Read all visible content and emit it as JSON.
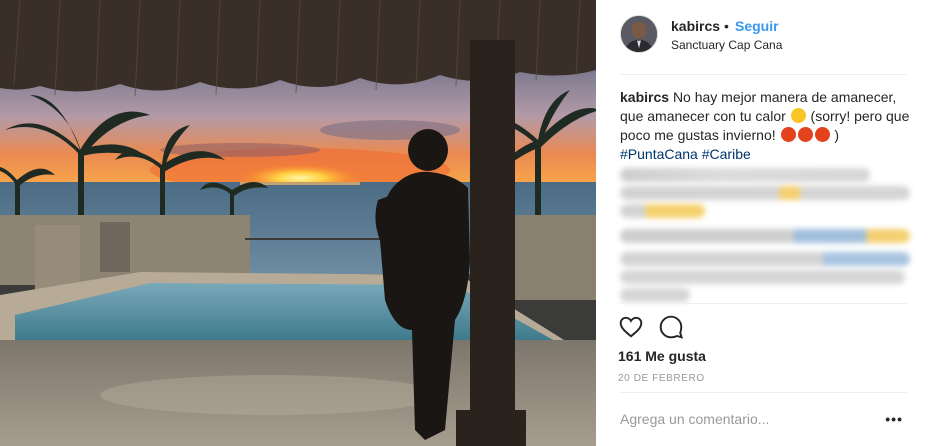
{
  "post": {
    "username": "kabircs",
    "separator": "•",
    "follow_label": "Seguir",
    "location": "Sanctuary Cap Cana",
    "caption_username": "kabircs",
    "caption_part1": "No hay mejor manera de amanecer, que amanecer con tu calor",
    "caption_part2": "(sorry! pero que poco me gustas invierno!",
    "caption_part3": ")",
    "hashtags": [
      "#PuntaCana",
      "#Caribe"
    ],
    "likes": "161 Me gusta",
    "date": "20 DE FEBRERO",
    "add_comment_placeholder": "Agrega un comentario...",
    "more_label": "•••"
  },
  "colors": {
    "accent": "#3897f0",
    "hashtag": "#003569",
    "muted": "#999999",
    "text": "#262626"
  },
  "icons": {
    "like": "heart-icon",
    "comment": "comment-icon",
    "more": "ellipsis-icon"
  }
}
